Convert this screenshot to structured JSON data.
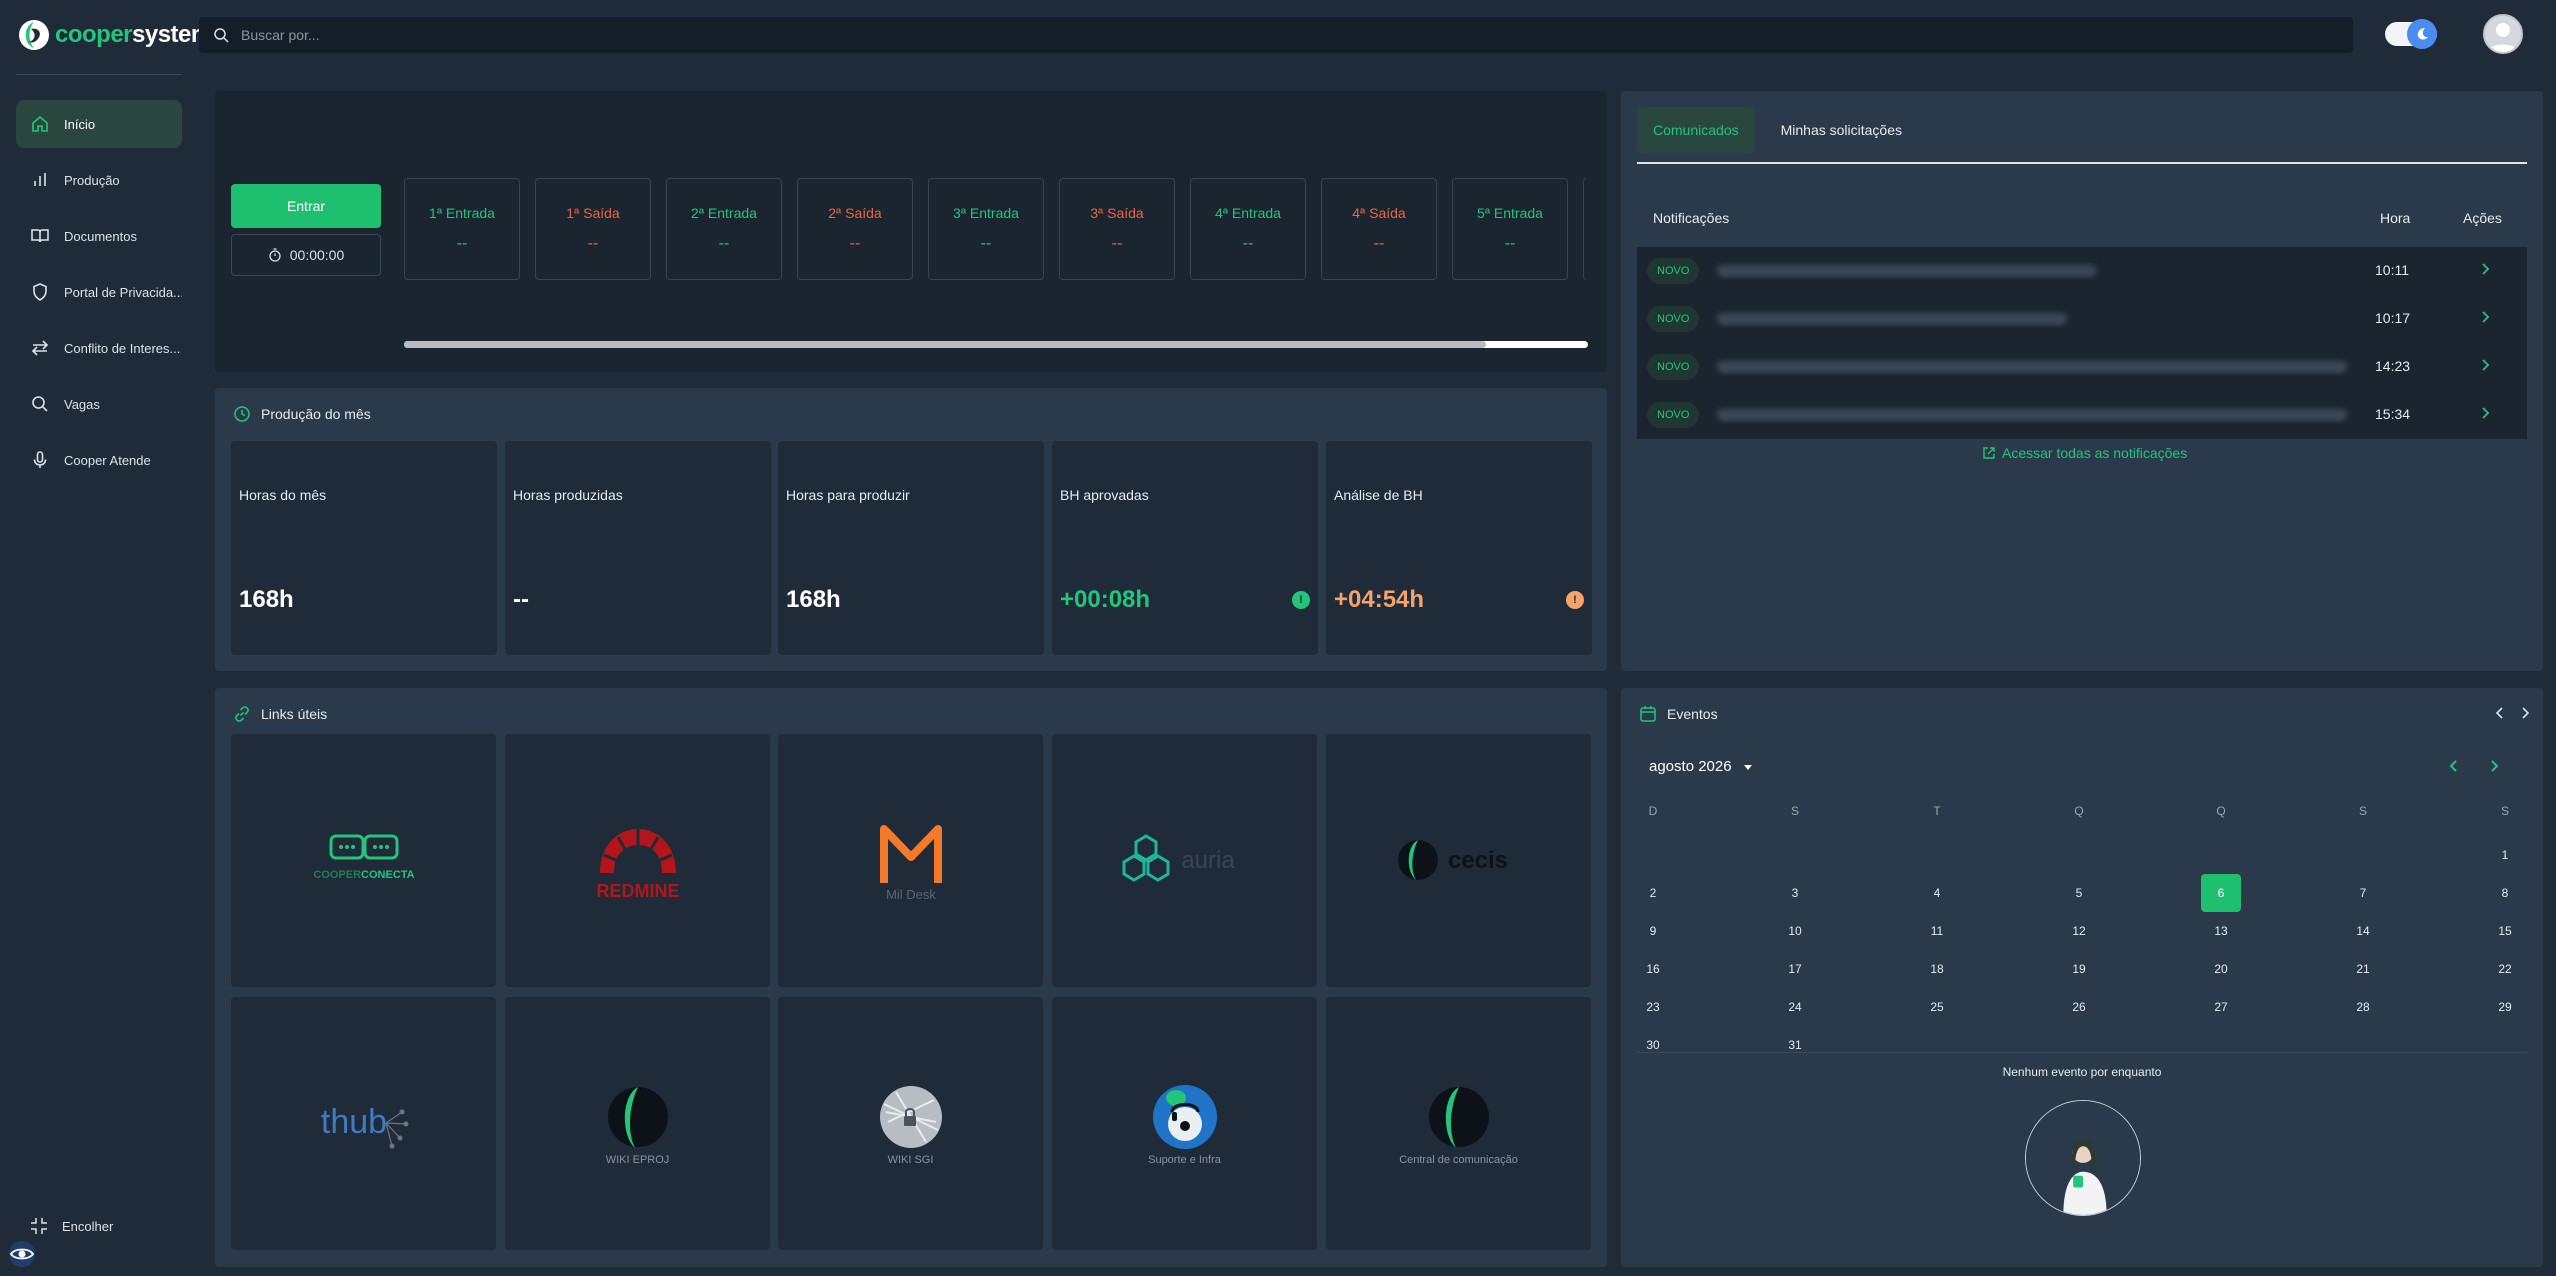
{
  "brand": {
    "prefix": "cooper",
    "suffix": "system"
  },
  "search": {
    "placeholder": "Buscar por..."
  },
  "sidebar": {
    "items": [
      {
        "label": "Início",
        "icon": "home-icon"
      },
      {
        "label": "Produção",
        "icon": "bar-chart-icon"
      },
      {
        "label": "Documentos",
        "icon": "book-icon"
      },
      {
        "label": "Portal de Privacida...",
        "icon": "shield-icon"
      },
      {
        "label": "Conflito de Interes...",
        "icon": "arrows-swap-icon"
      },
      {
        "label": "Vagas",
        "icon": "search-icon"
      },
      {
        "label": "Cooper Atende",
        "icon": "microphone-icon"
      }
    ],
    "collapse_label": "Encolher"
  },
  "punch": {
    "button_label": "Entrar",
    "timer": "00:00:00",
    "slots": [
      {
        "label": "1ª Entrada",
        "value": "--",
        "kind": "in"
      },
      {
        "label": "1ª Saída",
        "value": "--",
        "kind": "out"
      },
      {
        "label": "2ª Entrada",
        "value": "--",
        "kind": "in"
      },
      {
        "label": "2ª Saída",
        "value": "--",
        "kind": "out"
      },
      {
        "label": "3ª Entrada",
        "value": "--",
        "kind": "in"
      },
      {
        "label": "3ª Saída",
        "value": "--",
        "kind": "out"
      },
      {
        "label": "4ª Entrada",
        "value": "--",
        "kind": "in"
      },
      {
        "label": "4ª Saída",
        "value": "--",
        "kind": "out"
      },
      {
        "label": "5ª Entrada",
        "value": "--",
        "kind": "in"
      }
    ]
  },
  "production": {
    "title": "Produção do mês",
    "stats": [
      {
        "label": "Horas do mês",
        "value": "168h"
      },
      {
        "label": "Horas produzidas",
        "value": "--"
      },
      {
        "label": "Horas para produzir",
        "value": "168h"
      },
      {
        "label": "BH aprovadas",
        "value": "+00:08h",
        "accent": "#22c57a"
      },
      {
        "label": "Análise de BH",
        "value": "+04:54h",
        "accent": "#f5a26b"
      }
    ]
  },
  "links": {
    "title": "Links úteis",
    "tiles": [
      {
        "name": "cooperconecta",
        "caption": ""
      },
      {
        "name": "redmine",
        "caption": ""
      },
      {
        "name": "mil-desk",
        "caption": ""
      },
      {
        "name": "auria",
        "caption": ""
      },
      {
        "name": "cecis",
        "caption": ""
      },
      {
        "name": "thub",
        "caption": ""
      },
      {
        "name": "wiki-eproj",
        "caption": "WIKI EPROJ"
      },
      {
        "name": "wiki-sgi",
        "caption": "WIKI SGI"
      },
      {
        "name": "suporte-infra",
        "caption": "Suporte e Infra"
      },
      {
        "name": "central-comunicacao",
        "caption": "Central de comunicação"
      }
    ]
  },
  "comms": {
    "tabs": [
      "Comunicados",
      "Minhas solicitações"
    ],
    "headers": {
      "notifications": "Notificações",
      "time": "Hora",
      "actions": "Ações"
    },
    "rows": [
      {
        "badge": "NOVO",
        "time": "10:11"
      },
      {
        "badge": "NOVO",
        "time": "10:17"
      },
      {
        "badge": "NOVO",
        "time": "14:23"
      },
      {
        "badge": "NOVO",
        "time": "15:34"
      }
    ],
    "all_link": "Acessar todas as notificações"
  },
  "events": {
    "title": "Eventos",
    "month": "agosto 2026",
    "weekdays": [
      "D",
      "S",
      "T",
      "Q",
      "Q",
      "S",
      "S"
    ],
    "first_weekday": 6,
    "days_in_month": 31,
    "today": 6,
    "empty_label": "Nenhum evento por enquanto"
  },
  "colors": {
    "accent": "#22c57a",
    "out": "#f0643c",
    "button": "#1ec06f"
  }
}
